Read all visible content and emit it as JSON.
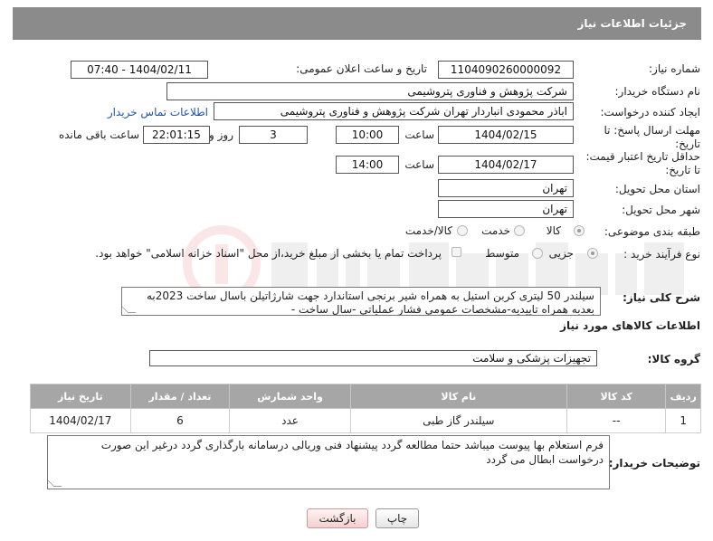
{
  "header": {
    "title": "جزئیات اطلاعات نیاز"
  },
  "fields": {
    "need_number_label": "شماره نیاز:",
    "need_number": "1104090260000092",
    "announce_label": "تاریخ و ساعت اعلان عمومی:",
    "announce_value": "1404/02/11 - 07:40",
    "buyer_org_label": "نام دستگاه خریدار:",
    "buyer_org": "شرکت پژوهش و فناوری پتروشیمی",
    "creator_label": "ایجاد کننده درخواست:",
    "creator": "اباذر محمودی انباردار تهران شرکت پژوهش و فناوری پتروشیمی",
    "contact_link": "اطلاعات تماس خریدار",
    "reply_deadline_label_1": "مهلت ارسال پاسخ: تا",
    "reply_deadline_label_2": "تاریخ:",
    "reply_date": "1404/02/15",
    "time_label": "ساعت",
    "reply_time": "10:00",
    "days_value": "3",
    "days_label": "روز و",
    "remaining_time": "22:01:15",
    "remaining_label": "ساعت باقی مانده",
    "price_validity_label_1": "حداقل تاریخ اعتبار قیمت:",
    "price_validity_label_2": "تا تاریخ:",
    "price_date": "1404/02/17",
    "price_time": "14:00",
    "province_label": "استان محل تحویل:",
    "province": "تهران",
    "city_label": "شهر محل تحویل:",
    "city": "تهران",
    "category_label": "طبقه بندی موضوعی:",
    "category_options": [
      "کالا",
      "خدمت",
      "کالا/خدمت"
    ],
    "process_label": "نوع فرآیند خرید :",
    "process_options": [
      "جزیی",
      "متوسط"
    ],
    "payment_note": "پرداخت تمام یا بخشی از مبلغ خرید،از محل \"اسناد خزانه اسلامی\" خواهد بود.",
    "description_label": "شرح کلی نیاز:",
    "description": "سیلندر 50 لیتری کربن استیل به همراه شیر برنجی استاندارد جهت شارژاتیلن باسال ساخت 2023به بعدبه همراه تاییدیه-مشخصات عمومی فشار عملیاتی -سال ساخت -"
  },
  "goods": {
    "section_title": "اطلاعات کالاهای مورد نیاز",
    "group_label": "گروه کالا:",
    "group_value": "تجهیزات پزشکی و سلامت",
    "columns": [
      "ردیف",
      "کد کالا",
      "نام کالا",
      "واحد شمارش",
      "تعداد / مقدار",
      "تاریخ نیاز"
    ],
    "rows": [
      {
        "row": "1",
        "code": "--",
        "name": "سیلندر گاز طبی",
        "unit": "عدد",
        "qty": "6",
        "date": "1404/02/17"
      }
    ]
  },
  "buyer_notes": {
    "label": "توضیحات خریدار:",
    "text": "فرم استعلام بها پیوست میباشد حتما مطالعه گردد پیشنهاد فنی وریالی درسامانه بارگذاری گردد درغیر این صورت درخواست ابطال می گردد"
  },
  "buttons": {
    "print": "چاپ",
    "back": "بازگشت"
  },
  "colors": {
    "header_bg": "#8b8b8b",
    "table_header_bg": "#a6a6a6",
    "link": "#2255aa",
    "back_button": "#f5cfcf"
  }
}
